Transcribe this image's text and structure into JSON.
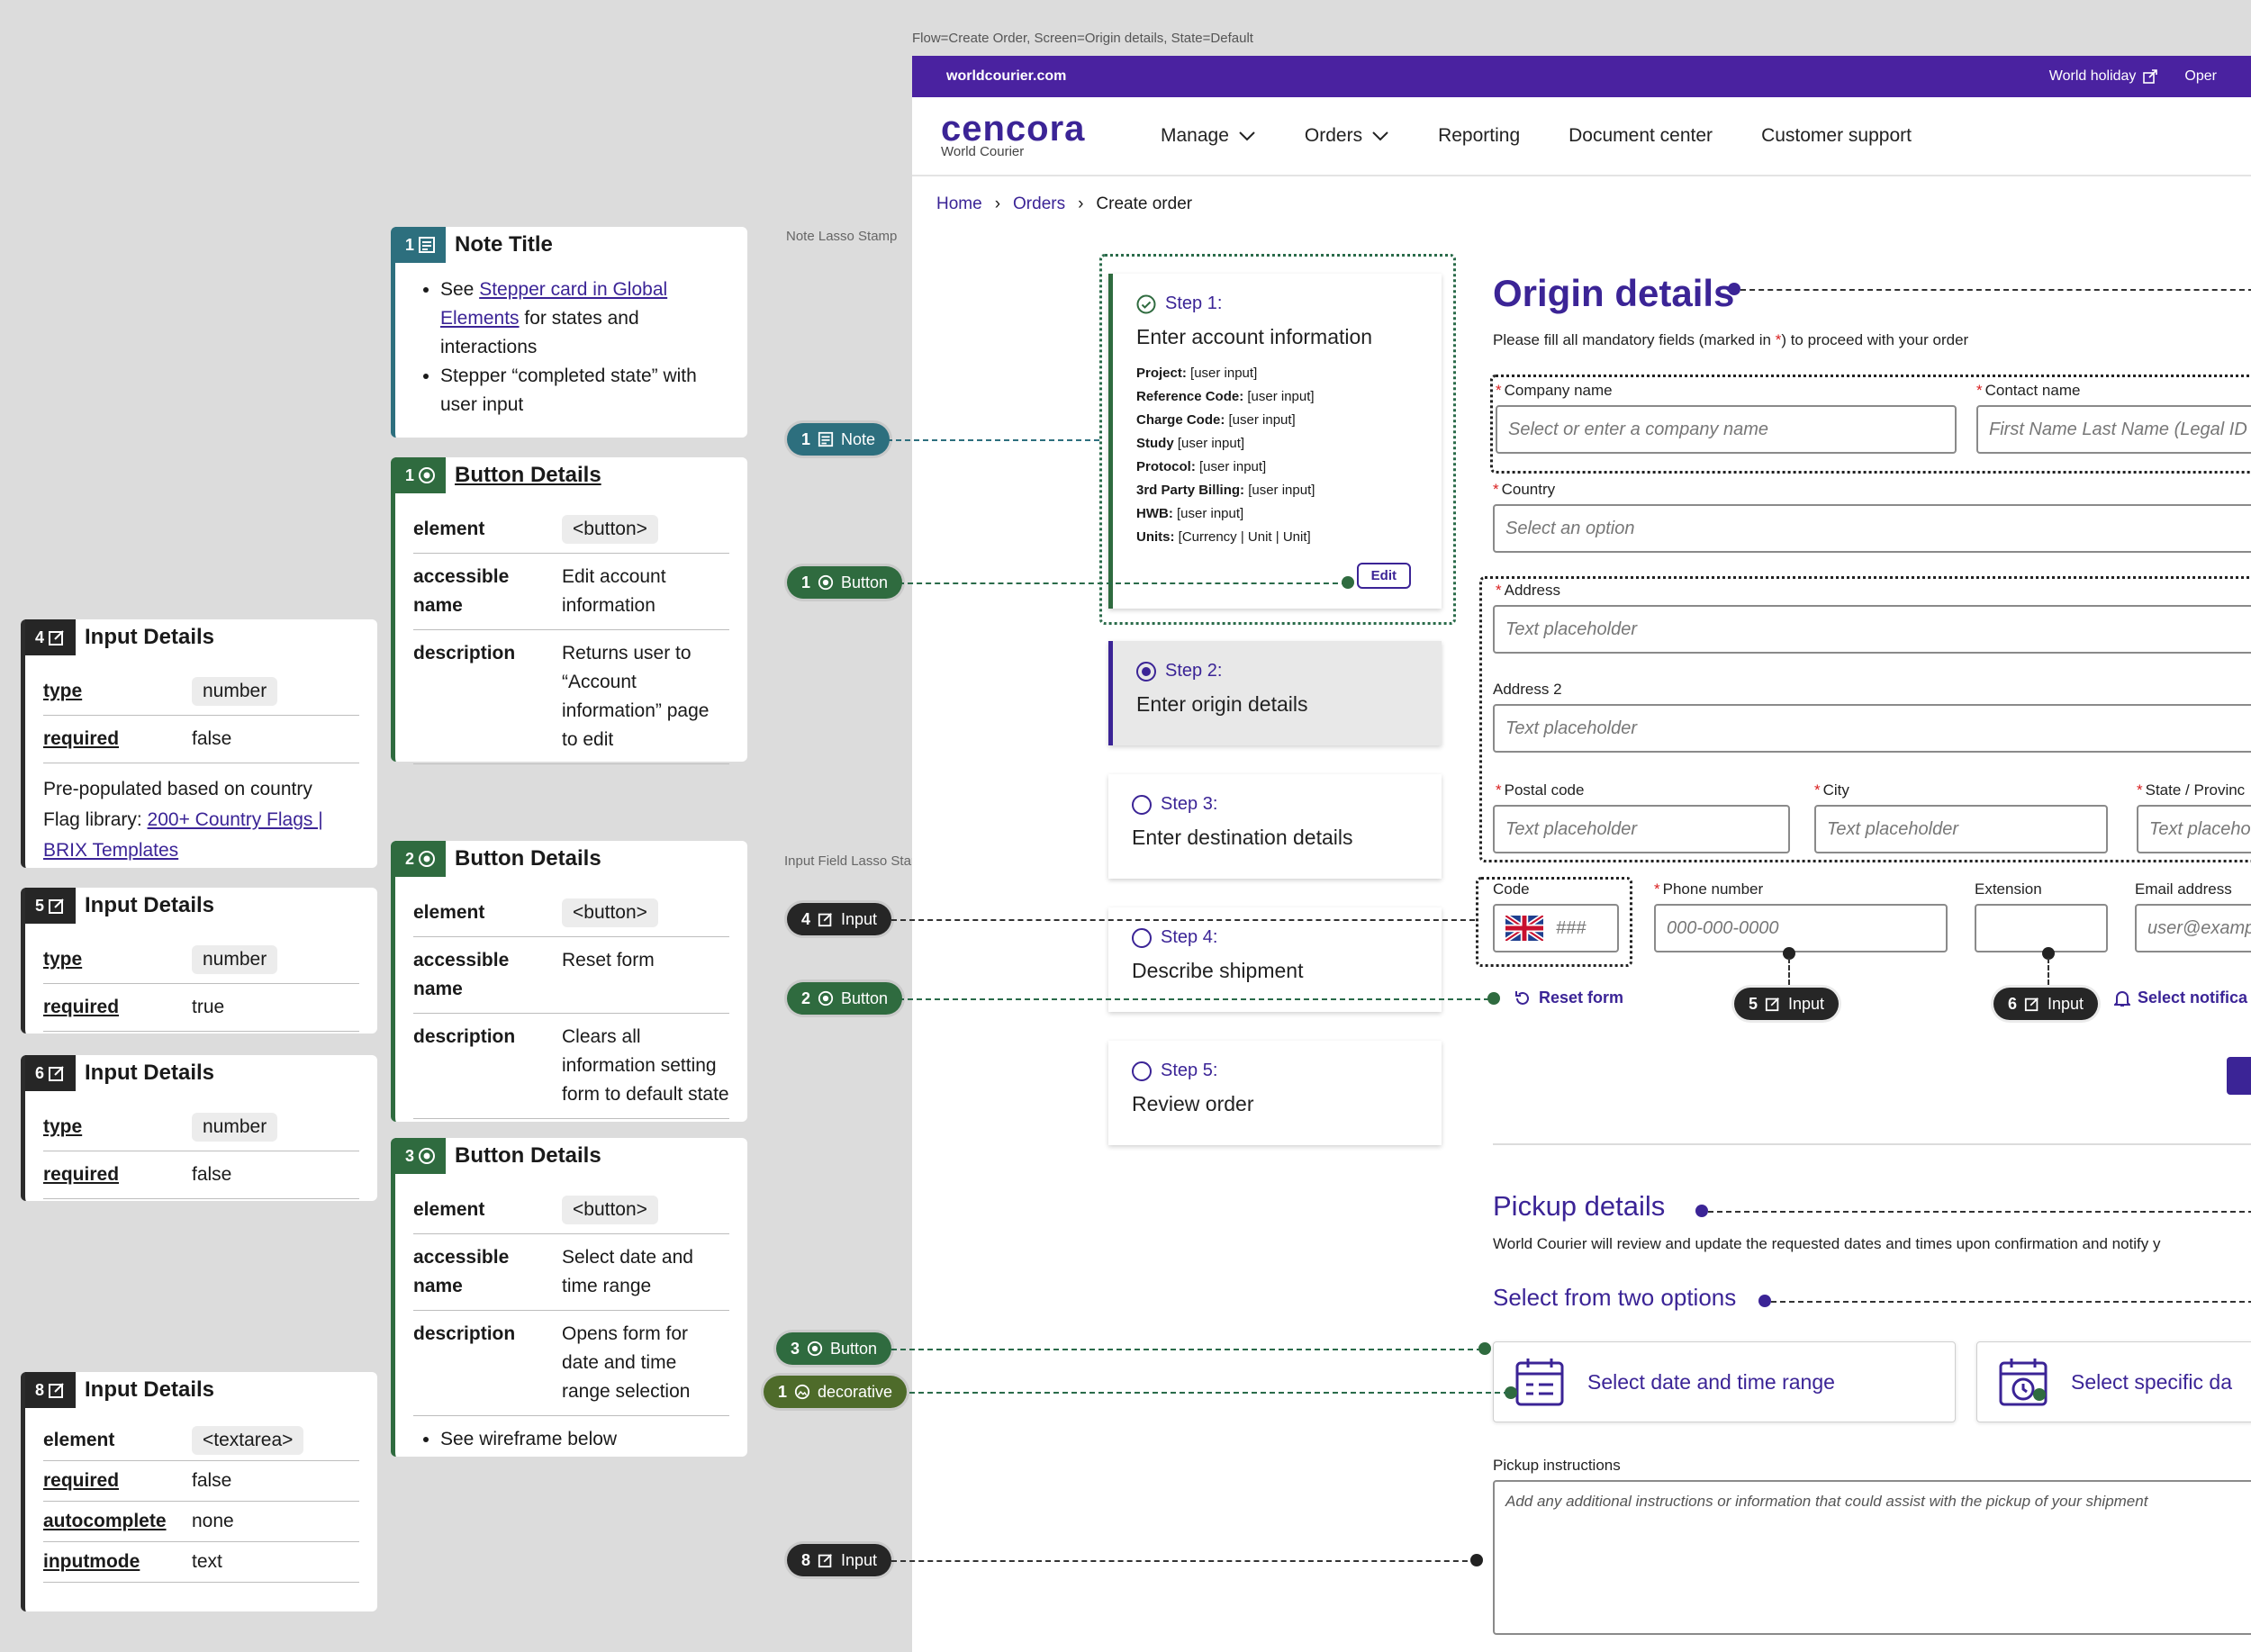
{
  "frame_label": "Flow=Create Order, Screen=Origin details, State=Default",
  "stamps": {
    "note_lasso": "Note Lasso Stamp",
    "input_lasso": "Input Field Lasso Stamp"
  },
  "cards": {
    "note1": {
      "num": "1",
      "title": "Note Title",
      "bullet1_pre": "See ",
      "bullet1_link": "Stepper card in Global Elements",
      "bullet1_post": " for states and interactions",
      "bullet2": "Stepper “completed state” with user input"
    },
    "button1": {
      "num": "1",
      "title": "Button Details",
      "element_k": "element",
      "element_v": "<button>",
      "name_k": "accessible name",
      "name_v": "Edit account information",
      "desc_k": "description",
      "desc_v": "Returns user to “Account information” page to edit"
    },
    "button2": {
      "num": "2",
      "title": "Button Details",
      "element_k": "element",
      "element_v": "<button>",
      "name_k": "accessible name",
      "name_v": "Reset form",
      "desc_k": "description",
      "desc_v": "Clears all information setting form to default state"
    },
    "button3": {
      "num": "3",
      "title": "Button Details",
      "element_k": "element",
      "element_v": "<button>",
      "name_k": "accessible name",
      "name_v": "Select date and time range",
      "desc_k": "description",
      "desc_v": "Opens form for date and time range selection",
      "bullet": "See wireframe below"
    },
    "input4": {
      "num": "4",
      "title": "Input Details",
      "type_k": "type",
      "type_v": "number",
      "req_k": "required",
      "req_v": "false",
      "text1": "Pre-populated based on country",
      "text2_pre": "Flag library: ",
      "text2_link": "200+ Country Flags | BRIX Templates"
    },
    "input5": {
      "num": "5",
      "title": "Input Details",
      "type_k": "type",
      "type_v": "number",
      "req_k": "required",
      "req_v": "true"
    },
    "input6": {
      "num": "6",
      "title": "Input Details",
      "type_k": "type",
      "type_v": "number",
      "req_k": "required",
      "req_v": "false"
    },
    "input8": {
      "num": "8",
      "title": "Input Details",
      "element_k": "element",
      "element_v": "<textarea>",
      "req_k": "required",
      "req_v": "false",
      "auto_k": "autocomplete",
      "auto_v": "none",
      "mode_k": "inputmode",
      "mode_v": "text"
    }
  },
  "tags": {
    "note1": {
      "num": "1",
      "label": "Note"
    },
    "button1": {
      "num": "1",
      "label": "Button"
    },
    "input4": {
      "num": "4",
      "label": "Input"
    },
    "button2": {
      "num": "2",
      "label": "Button"
    },
    "button3": {
      "num": "3",
      "label": "Button"
    },
    "deco1": {
      "num": "1",
      "label": "decorative"
    },
    "input8": {
      "num": "8",
      "label": "Input"
    },
    "input5": {
      "num": "5",
      "label": "Input"
    },
    "input6": {
      "num": "6",
      "label": "Input"
    }
  },
  "app": {
    "topbar": {
      "url": "worldcourier.com",
      "holiday": "World holiday",
      "open": "Oper"
    },
    "logo": {
      "brand": "cencora",
      "sub": "World Courier"
    },
    "menu": {
      "manage": "Manage",
      "orders": "Orders",
      "reporting": "Reporting",
      "documents": "Document center",
      "support": "Customer support"
    },
    "breadcrumb": {
      "home": "Home",
      "orders": "Orders",
      "current": "Create order"
    },
    "steps": {
      "s1_label": "Step 1:",
      "s1_title": "Enter account information",
      "s1_fields": [
        {
          "k": "Project:",
          "v": " [user input]"
        },
        {
          "k": "Reference Code:",
          "v": " [user input]"
        },
        {
          "k": "Charge Code:",
          "v": " [user input]"
        },
        {
          "k": "Study",
          "v": " [user input]"
        },
        {
          "k": "Protocol:",
          "v": " [user input]"
        },
        {
          "k": "3rd Party Billing:",
          "v": " [user input]"
        },
        {
          "k": "HWB:",
          "v": " [user input]"
        },
        {
          "k": "Units:",
          "v": " [Currency | Unit | Unit]"
        }
      ],
      "edit": "Edit",
      "s2_label": "Step 2:",
      "s2_title": "Enter origin details",
      "s3_label": "Step 3:",
      "s3_title": "Enter destination details",
      "s4_label": "Step 4:",
      "s4_title": "Describe shipment",
      "s5_label": "Step 5:",
      "s5_title": "Review order"
    },
    "form": {
      "title": "Origin details",
      "subtitle_pre": "Please fill all mandatory fields (marked in ",
      "subtitle_star": "*",
      "subtitle_post": ") to proceed with your order",
      "company_label": "Company name",
      "company_ph": "Select or enter a company name",
      "contact_label": "Contact name",
      "contact_ph": "First Name Last Name (Legal ID",
      "country_label": "Country",
      "country_ph": "Select an option",
      "address_label": "Address",
      "address_ph": "Text placeholder",
      "address2_label": "Address 2",
      "address2_ph": "Text placeholder",
      "postal_label": "Postal code",
      "postal_ph": "Text placeholder",
      "city_label": "City",
      "city_ph": "Text placeholder",
      "state_label": "State / Provinc",
      "state_ph": "Text placeho",
      "code_label": "Code",
      "code_ph": "###",
      "phone_label": "Phone number",
      "phone_ph": "000-000-0000",
      "ext_label": "Extension",
      "email_label": "Email address",
      "email_ph": "user@examp",
      "reset": "Reset form",
      "notif": "Select notifica",
      "req_star": "*"
    },
    "pickup": {
      "title": "Pickup details",
      "subtitle": "World Courier will review and update the requested dates and times upon confirmation and notify y",
      "options_title": "Select from two options",
      "opt1": "Select date and time range",
      "opt2": "Select specific da",
      "instructions_label": "Pickup instructions",
      "instructions_ph": "Add any additional instructions or information that could assist with the pickup of your shipment"
    }
  }
}
